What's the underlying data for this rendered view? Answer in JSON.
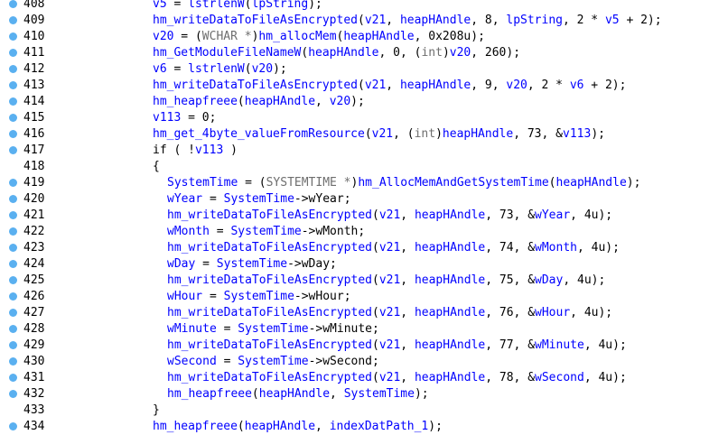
{
  "lines": [
    {
      "n": "408",
      "bp": true,
      "indent": 0,
      "toks": [
        [
          "v",
          "v5"
        ],
        [
          "p",
          " = "
        ],
        [
          "f",
          "lstrlenW"
        ],
        [
          "p",
          "("
        ],
        [
          "v",
          "lpString"
        ],
        [
          "p",
          ");"
        ]
      ]
    },
    {
      "n": "409",
      "bp": true,
      "indent": 0,
      "toks": [
        [
          "f",
          "hm_writeDataToFileAsEncrypted"
        ],
        [
          "p",
          "("
        ],
        [
          "v",
          "v21"
        ],
        [
          "p",
          ", "
        ],
        [
          "v",
          "heapHAndle"
        ],
        [
          "p",
          ", 8, "
        ],
        [
          "v",
          "lpString"
        ],
        [
          "p",
          ", 2 * "
        ],
        [
          "v",
          "v5"
        ],
        [
          "p",
          " + 2);"
        ]
      ]
    },
    {
      "n": "410",
      "bp": true,
      "indent": 0,
      "toks": [
        [
          "v",
          "v20"
        ],
        [
          "p",
          " = ("
        ],
        [
          "lib",
          "WCHAR *"
        ],
        [
          "p",
          ")"
        ],
        [
          "f",
          "hm_allocMem"
        ],
        [
          "p",
          "("
        ],
        [
          "v",
          "heapHAndle"
        ],
        [
          "p",
          ", 0x208u);"
        ]
      ]
    },
    {
      "n": "411",
      "bp": true,
      "indent": 0,
      "toks": [
        [
          "f",
          "hm_GetModuleFileNameW"
        ],
        [
          "p",
          "("
        ],
        [
          "v",
          "heapHAndle"
        ],
        [
          "p",
          ", 0, ("
        ],
        [
          "lib",
          "int"
        ],
        [
          "p",
          ")"
        ],
        [
          "v",
          "v20"
        ],
        [
          "p",
          ", 260);"
        ]
      ]
    },
    {
      "n": "412",
      "bp": true,
      "indent": 0,
      "toks": [
        [
          "v",
          "v6"
        ],
        [
          "p",
          " = "
        ],
        [
          "f",
          "lstrlenW"
        ],
        [
          "p",
          "("
        ],
        [
          "v",
          "v20"
        ],
        [
          "p",
          ");"
        ]
      ]
    },
    {
      "n": "413",
      "bp": true,
      "indent": 0,
      "toks": [
        [
          "f",
          "hm_writeDataToFileAsEncrypted"
        ],
        [
          "p",
          "("
        ],
        [
          "v",
          "v21"
        ],
        [
          "p",
          ", "
        ],
        [
          "v",
          "heapHAndle"
        ],
        [
          "p",
          ", 9, "
        ],
        [
          "v",
          "v20"
        ],
        [
          "p",
          ", 2 * "
        ],
        [
          "v",
          "v6"
        ],
        [
          "p",
          " + 2);"
        ]
      ]
    },
    {
      "n": "414",
      "bp": true,
      "indent": 0,
      "toks": [
        [
          "f",
          "hm_heapfreee"
        ],
        [
          "p",
          "("
        ],
        [
          "v",
          "heapHAndle"
        ],
        [
          "p",
          ", "
        ],
        [
          "v",
          "v20"
        ],
        [
          "p",
          ");"
        ]
      ]
    },
    {
      "n": "415",
      "bp": true,
      "indent": 0,
      "toks": [
        [
          "v",
          "v113"
        ],
        [
          "p",
          " = 0;"
        ]
      ]
    },
    {
      "n": "416",
      "bp": true,
      "indent": 0,
      "toks": [
        [
          "f",
          "hm_get_4byte_valueFromResource"
        ],
        [
          "p",
          "("
        ],
        [
          "v",
          "v21"
        ],
        [
          "p",
          ", ("
        ],
        [
          "lib",
          "int"
        ],
        [
          "p",
          ")"
        ],
        [
          "v",
          "heapHAndle"
        ],
        [
          "p",
          ", 73, &"
        ],
        [
          "v",
          "v113"
        ],
        [
          "p",
          ");"
        ]
      ]
    },
    {
      "n": "417",
      "bp": true,
      "indent": 0,
      "toks": [
        [
          "p",
          "if ( !"
        ],
        [
          "v",
          "v113"
        ],
        [
          "p",
          " )"
        ]
      ]
    },
    {
      "n": "418",
      "bp": false,
      "indent": 0,
      "toks": [
        [
          "p",
          "{"
        ]
      ]
    },
    {
      "n": "419",
      "bp": true,
      "indent": 1,
      "toks": [
        [
          "v",
          "SystemTime"
        ],
        [
          "p",
          " = ("
        ],
        [
          "lib",
          "SYSTEMTIME *"
        ],
        [
          "p",
          ")"
        ],
        [
          "f",
          "hm_AllocMemAndGetSystemTime"
        ],
        [
          "p",
          "("
        ],
        [
          "v",
          "heapHAndle"
        ],
        [
          "p",
          ");"
        ]
      ]
    },
    {
      "n": "420",
      "bp": true,
      "indent": 1,
      "toks": [
        [
          "v",
          "wYear"
        ],
        [
          "p",
          " = "
        ],
        [
          "v",
          "SystemTime"
        ],
        [
          "p",
          "->wYear;"
        ]
      ]
    },
    {
      "n": "421",
      "bp": true,
      "indent": 1,
      "toks": [
        [
          "f",
          "hm_writeDataToFileAsEncrypted"
        ],
        [
          "p",
          "("
        ],
        [
          "v",
          "v21"
        ],
        [
          "p",
          ", "
        ],
        [
          "v",
          "heapHAndle"
        ],
        [
          "p",
          ", 73, &"
        ],
        [
          "v",
          "wYear"
        ],
        [
          "p",
          ", 4u);"
        ]
      ]
    },
    {
      "n": "422",
      "bp": true,
      "indent": 1,
      "toks": [
        [
          "v",
          "wMonth"
        ],
        [
          "p",
          " = "
        ],
        [
          "v",
          "SystemTime"
        ],
        [
          "p",
          "->wMonth;"
        ]
      ]
    },
    {
      "n": "423",
      "bp": true,
      "indent": 1,
      "toks": [
        [
          "f",
          "hm_writeDataToFileAsEncrypted"
        ],
        [
          "p",
          "("
        ],
        [
          "v",
          "v21"
        ],
        [
          "p",
          ", "
        ],
        [
          "v",
          "heapHAndle"
        ],
        [
          "p",
          ", 74, &"
        ],
        [
          "v",
          "wMonth"
        ],
        [
          "p",
          ", 4u);"
        ]
      ]
    },
    {
      "n": "424",
      "bp": true,
      "indent": 1,
      "toks": [
        [
          "v",
          "wDay"
        ],
        [
          "p",
          " = "
        ],
        [
          "v",
          "SystemTime"
        ],
        [
          "p",
          "->wDay;"
        ]
      ]
    },
    {
      "n": "425",
      "bp": true,
      "indent": 1,
      "toks": [
        [
          "f",
          "hm_writeDataToFileAsEncrypted"
        ],
        [
          "p",
          "("
        ],
        [
          "v",
          "v21"
        ],
        [
          "p",
          ", "
        ],
        [
          "v",
          "heapHAndle"
        ],
        [
          "p",
          ", 75, &"
        ],
        [
          "v",
          "wDay"
        ],
        [
          "p",
          ", 4u);"
        ]
      ]
    },
    {
      "n": "426",
      "bp": true,
      "indent": 1,
      "toks": [
        [
          "v",
          "wHour"
        ],
        [
          "p",
          " = "
        ],
        [
          "v",
          "SystemTime"
        ],
        [
          "p",
          "->wHour;"
        ]
      ]
    },
    {
      "n": "427",
      "bp": true,
      "indent": 1,
      "toks": [
        [
          "f",
          "hm_writeDataToFileAsEncrypted"
        ],
        [
          "p",
          "("
        ],
        [
          "v",
          "v21"
        ],
        [
          "p",
          ", "
        ],
        [
          "v",
          "heapHAndle"
        ],
        [
          "p",
          ", 76, &"
        ],
        [
          "v",
          "wHour"
        ],
        [
          "p",
          ", 4u);"
        ]
      ]
    },
    {
      "n": "428",
      "bp": true,
      "indent": 1,
      "toks": [
        [
          "v",
          "wMinute"
        ],
        [
          "p",
          " = "
        ],
        [
          "v",
          "SystemTime"
        ],
        [
          "p",
          "->wMinute;"
        ]
      ]
    },
    {
      "n": "429",
      "bp": true,
      "indent": 1,
      "toks": [
        [
          "f",
          "hm_writeDataToFileAsEncrypted"
        ],
        [
          "p",
          "("
        ],
        [
          "v",
          "v21"
        ],
        [
          "p",
          ", "
        ],
        [
          "v",
          "heapHAndle"
        ],
        [
          "p",
          ", 77, &"
        ],
        [
          "v",
          "wMinute"
        ],
        [
          "p",
          ", 4u);"
        ]
      ]
    },
    {
      "n": "430",
      "bp": true,
      "indent": 1,
      "toks": [
        [
          "v",
          "wSecond"
        ],
        [
          "p",
          " = "
        ],
        [
          "v",
          "SystemTime"
        ],
        [
          "p",
          "->wSecond;"
        ]
      ]
    },
    {
      "n": "431",
      "bp": true,
      "indent": 1,
      "toks": [
        [
          "f",
          "hm_writeDataToFileAsEncrypted"
        ],
        [
          "p",
          "("
        ],
        [
          "v",
          "v21"
        ],
        [
          "p",
          ", "
        ],
        [
          "v",
          "heapHAndle"
        ],
        [
          "p",
          ", 78, &"
        ],
        [
          "v",
          "wSecond"
        ],
        [
          "p",
          ", 4u);"
        ]
      ]
    },
    {
      "n": "432",
      "bp": true,
      "indent": 1,
      "toks": [
        [
          "f",
          "hm_heapfreee"
        ],
        [
          "p",
          "("
        ],
        [
          "v",
          "heapHAndle"
        ],
        [
          "p",
          ", "
        ],
        [
          "v",
          "SystemTime"
        ],
        [
          "p",
          ");"
        ]
      ]
    },
    {
      "n": "433",
      "bp": false,
      "indent": 0,
      "toks": [
        [
          "p",
          "}"
        ]
      ]
    },
    {
      "n": "434",
      "bp": true,
      "indent": 0,
      "toks": [
        [
          "f",
          "hm_heapfreee"
        ],
        [
          "p",
          "("
        ],
        [
          "v",
          "heapHAndle"
        ],
        [
          "p",
          ", "
        ],
        [
          "v",
          "indexDatPath_1"
        ],
        [
          "p",
          ");"
        ]
      ]
    }
  ],
  "colors": {
    "breakpoint": "#5ab0f0",
    "variable": "#0000ff",
    "function": "#0000ff",
    "type": "#6e6e6e"
  }
}
